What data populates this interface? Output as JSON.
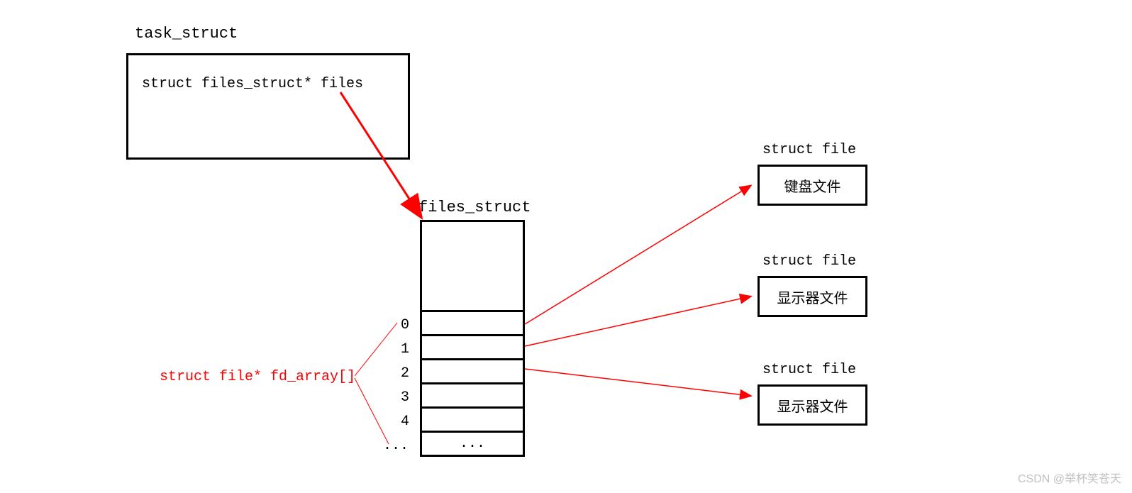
{
  "task_struct": {
    "title": "task_struct",
    "field": "struct files_struct* files"
  },
  "files_struct": {
    "title": "files_struct",
    "indices": [
      "0",
      "1",
      "2",
      "3",
      "4",
      "..."
    ],
    "ellipsis": "..."
  },
  "fd_array_label": "struct file* fd_array[]",
  "file_boxes": [
    {
      "label": "struct file",
      "content": "键盘文件"
    },
    {
      "label": "struct file",
      "content": "显示器文件"
    },
    {
      "label": "struct file",
      "content": "显示器文件"
    }
  ],
  "watermark": "CSDN @举杯笑苍天"
}
